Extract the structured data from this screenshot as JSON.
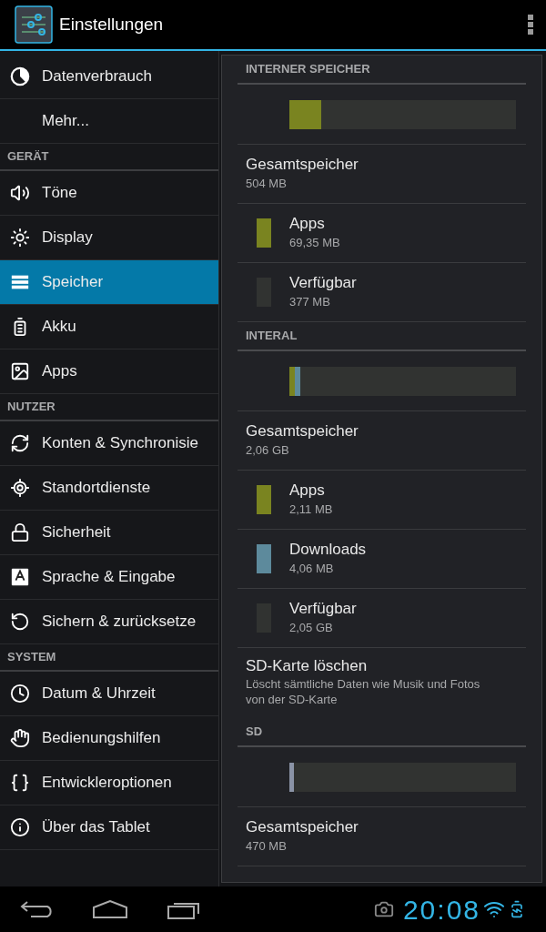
{
  "action_bar": {
    "title": "Einstellungen"
  },
  "sidebar": {
    "entries": [
      {
        "kind": "item",
        "label": "Datenverbrauch",
        "selected": false
      },
      {
        "kind": "item",
        "label": "Mehr...",
        "selected": false
      },
      {
        "kind": "header",
        "label": "GERÄT"
      },
      {
        "kind": "item",
        "label": "Töne",
        "selected": false
      },
      {
        "kind": "item",
        "label": "Display",
        "selected": false
      },
      {
        "kind": "item",
        "label": "Speicher",
        "selected": true
      },
      {
        "kind": "item",
        "label": "Akku",
        "selected": false
      },
      {
        "kind": "item",
        "label": "Apps",
        "selected": false
      },
      {
        "kind": "header",
        "label": "NUTZER"
      },
      {
        "kind": "item",
        "label": "Konten & Synchronisie",
        "selected": false
      },
      {
        "kind": "item",
        "label": "Standortdienste",
        "selected": false
      },
      {
        "kind": "item",
        "label": "Sicherheit",
        "selected": false
      },
      {
        "kind": "item",
        "label": "Sprache & Eingabe",
        "selected": false
      },
      {
        "kind": "item",
        "label": "Sichern & zurücksetze",
        "selected": false
      },
      {
        "kind": "header",
        "label": "SYSTEM"
      },
      {
        "kind": "item",
        "label": "Datum & Uhrzeit",
        "selected": false
      },
      {
        "kind": "item",
        "label": "Bedienungshilfen",
        "selected": false
      },
      {
        "kind": "item",
        "label": "Entwickleroptionen",
        "selected": false
      },
      {
        "kind": "item",
        "label": "Über das Tablet",
        "selected": false
      }
    ]
  },
  "storage": {
    "rows": [
      {
        "kind": "header",
        "label": "INTERNER SPEICHER"
      },
      {
        "kind": "bar",
        "segments": [
          {
            "color": "#7a8420",
            "level": 0.14
          }
        ]
      },
      {
        "kind": "total",
        "title": "Gesamtspeicher",
        "value": "504 MB"
      },
      {
        "kind": "legend",
        "title": "Apps",
        "value": "69,35 MB",
        "color": "#7a8420"
      },
      {
        "kind": "legend",
        "title": "Verfügbar",
        "value": "377 MB",
        "color": "#313331"
      },
      {
        "kind": "header",
        "label": "INTERAL"
      },
      {
        "kind": "bar",
        "segments": [
          {
            "color": "#7a8420",
            "level": 0.025
          },
          {
            "color": "#5d8a9c",
            "level": 0.025
          }
        ]
      },
      {
        "kind": "total",
        "title": "Gesamtspeicher",
        "value": "2,06 GB"
      },
      {
        "kind": "legend",
        "title": "Apps",
        "value": "2,11 MB",
        "color": "#7a8420"
      },
      {
        "kind": "legend",
        "title": "Downloads",
        "value": "4,06 MB",
        "color": "#5d8a9c"
      },
      {
        "kind": "legend",
        "title": "Verfügbar",
        "value": "2,05 GB",
        "color": "#313331"
      },
      {
        "kind": "action",
        "title": "SD-Karte löschen",
        "description": "Löscht sämtliche Daten wie Musik und Fotos von der SD-Karte"
      },
      {
        "kind": "header",
        "label": "SD"
      },
      {
        "kind": "bar",
        "segments": [
          {
            "color": "#8a93a6",
            "level": 0.02
          }
        ]
      },
      {
        "kind": "total",
        "title": "Gesamtspeicher",
        "value": "470 MB"
      }
    ]
  },
  "status_bar": {
    "time": "20:08"
  }
}
